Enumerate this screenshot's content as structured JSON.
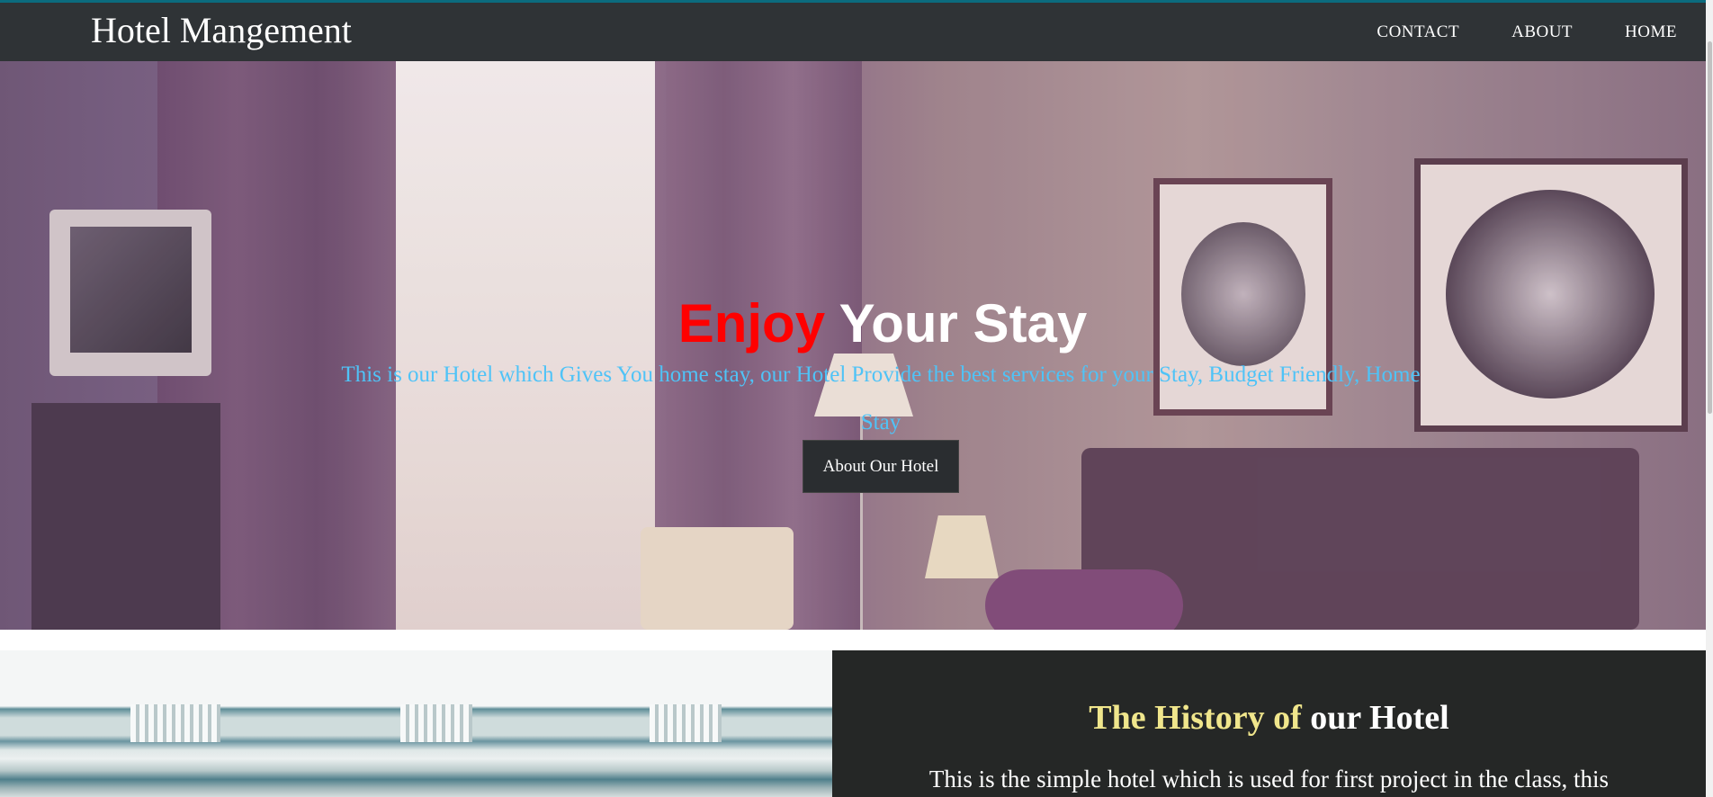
{
  "navbar": {
    "brand": "Hotel Mangement",
    "links": [
      "CONTACT",
      "ABOUT",
      "HOME"
    ]
  },
  "hero": {
    "title_highlight": "Enjoy",
    "title_rest": "Your Stay",
    "description": "This is our Hotel which Gives You home stay, our Hotel Provide the best services for your Stay, Budget Friendly, Home Stay",
    "button_label": "About Our Hotel"
  },
  "history": {
    "title_highlight": "The History of",
    "title_rest": "our Hotel",
    "text": "This is the simple hotel which is used for first project in the class, this"
  },
  "colors": {
    "navbar_bg": "#2f3336",
    "title_accent": "#ff0000",
    "description_text": "#4fc3f7",
    "history_bg": "#252726",
    "history_accent": "#f0e68c"
  }
}
